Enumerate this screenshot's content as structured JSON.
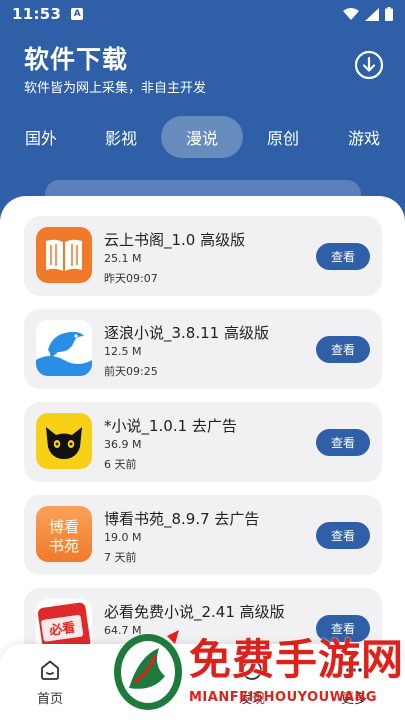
{
  "status": {
    "time": "11:53",
    "notification_letter": "A"
  },
  "header": {
    "title": "软件下载",
    "subtitle": "软件皆为网上采集，非自主开发"
  },
  "tabs": [
    {
      "label": "国外",
      "active": false
    },
    {
      "label": "影视",
      "active": false
    },
    {
      "label": "漫说",
      "active": true
    },
    {
      "label": "原创",
      "active": false
    },
    {
      "label": "游戏",
      "active": false
    }
  ],
  "apps": [
    {
      "name": "云上书阁_1.0 高级版",
      "size": "25.1 M",
      "date": "昨天09:07",
      "icon": "book-icon",
      "button": "查看"
    },
    {
      "name": "逐浪小说_3.8.11 高级版",
      "size": "12.5 M",
      "date": "前天09:25",
      "icon": "dolphin-icon",
      "button": "查看"
    },
    {
      "name": "*小说_1.0.1 去广告",
      "size": "36.9 M",
      "date": "6 天前",
      "icon": "black-cat-icon",
      "button": "查看"
    },
    {
      "name": "博看书苑_8.9.7 去广告",
      "size": "19.0 M",
      "date": "7 天前",
      "icon": "bokan-icon",
      "button": "查看",
      "icon_text": "博看书苑"
    },
    {
      "name": "必看免费小说_2.41 高级版",
      "size": "64.7 M",
      "date": "",
      "icon": "bikan-icon",
      "button": "查看"
    }
  ],
  "bottom_nav": [
    {
      "label": "首页",
      "icon": "home-icon"
    },
    {
      "label": "发现",
      "icon": "discover-icon"
    },
    {
      "label": "更多",
      "icon": "more-icon"
    }
  ],
  "watermark": {
    "text": "免费手游网",
    "subtext": "MIANFEISHOUYOUWANG"
  },
  "colors": {
    "primary": "#2f5fa6",
    "card_bg": "#f1f1f3",
    "watermark_red": "#e0201b"
  }
}
